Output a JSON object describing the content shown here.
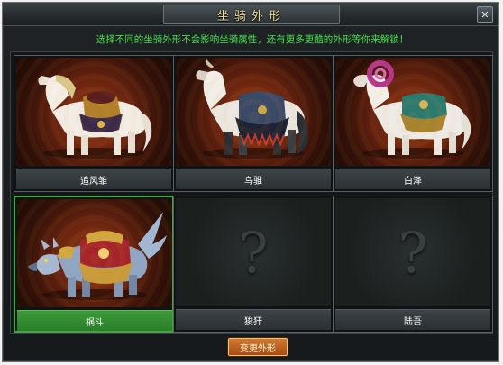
{
  "window": {
    "title": "坐骑外形",
    "close_label": "✕"
  },
  "hint": "选择不同的坐骑外形不会影响坐骑属性，还有更多更酷的外形等你来解锁！",
  "mounts": [
    {
      "name": "追风雏",
      "state": "unlocked",
      "icon": "white-horse-illustration"
    },
    {
      "name": "乌骓",
      "state": "unlocked",
      "icon": "dark-horse-illustration"
    },
    {
      "name": "白泽",
      "state": "unlocked",
      "icon": "white-ram-beast-illustration"
    },
    {
      "name": "祸斗",
      "state": "selected",
      "icon": "armored-wolf-illustration"
    },
    {
      "name": "狻犴",
      "state": "locked",
      "icon": "question-mark-icon",
      "placeholder": "?"
    },
    {
      "name": "陆吾",
      "state": "locked",
      "icon": "question-mark-icon",
      "placeholder": "?"
    }
  ],
  "actions": {
    "change_label": "变更外形"
  },
  "colors": {
    "hint_green": "#44e04a",
    "selected_green": "#3fa93b",
    "title_gold": "#f2e0a0",
    "button_orange": "#c0661f"
  }
}
